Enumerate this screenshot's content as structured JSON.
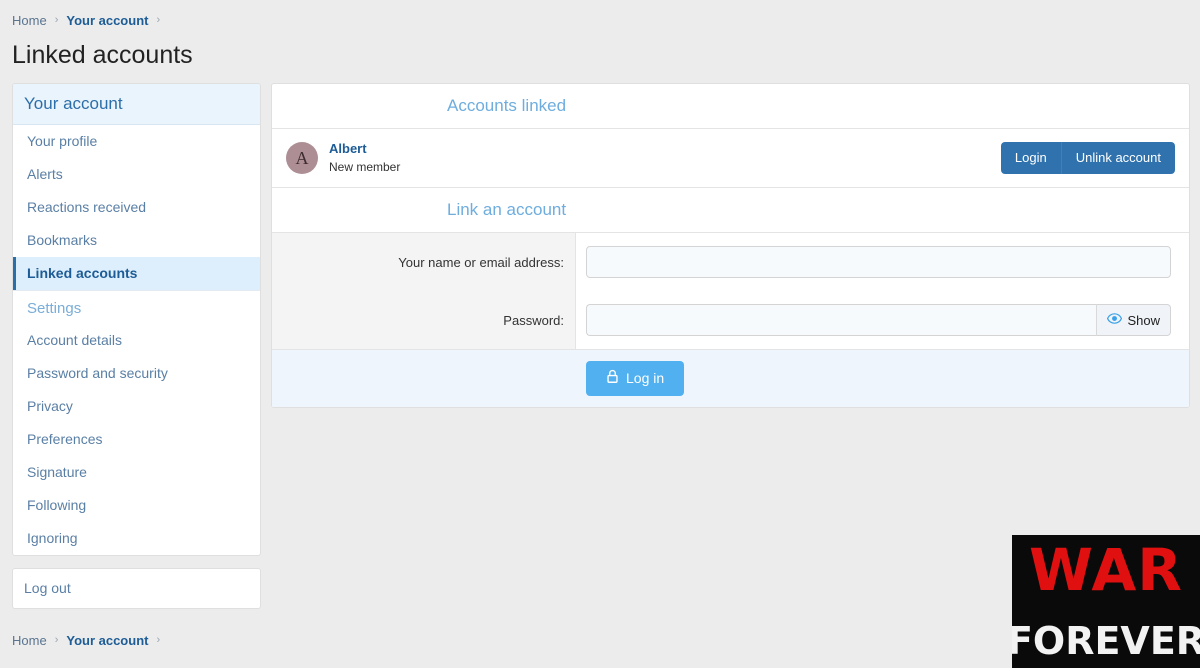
{
  "breadcrumb": {
    "home": "Home",
    "account": "Your account",
    "separator": "›"
  },
  "page": {
    "title": "Linked accounts"
  },
  "sidebar": {
    "header": "Your account",
    "items": [
      {
        "label": "Your profile",
        "active": false,
        "type": "link"
      },
      {
        "label": "Alerts",
        "active": false,
        "type": "link"
      },
      {
        "label": "Reactions received",
        "active": false,
        "type": "link"
      },
      {
        "label": "Bookmarks",
        "active": false,
        "type": "link"
      },
      {
        "label": "Linked accounts",
        "active": true,
        "type": "link"
      },
      {
        "label": "Settings",
        "active": false,
        "type": "sub-header"
      },
      {
        "label": "Account details",
        "active": false,
        "type": "link"
      },
      {
        "label": "Password and security",
        "active": false,
        "type": "link"
      },
      {
        "label": "Privacy",
        "active": false,
        "type": "link"
      },
      {
        "label": "Preferences",
        "active": false,
        "type": "link"
      },
      {
        "label": "Signature",
        "active": false,
        "type": "link"
      },
      {
        "label": "Following",
        "active": false,
        "type": "link"
      },
      {
        "label": "Ignoring",
        "active": false,
        "type": "link"
      }
    ],
    "logout": "Log out"
  },
  "main": {
    "accounts_linked_header": "Accounts linked",
    "linked_account": {
      "avatar_initial": "A",
      "name": "Albert",
      "user_title": "New member",
      "login_button": "Login",
      "unlink_button": "Unlink account"
    },
    "link_account_header": "Link an account",
    "form": {
      "name_label": "Your name or email address:",
      "name_value": "",
      "name_placeholder": "",
      "password_label": "Password:",
      "password_value": "",
      "password_placeholder": "",
      "show_button": "Show",
      "submit_button": "Log in"
    }
  },
  "banner": {
    "line1": "WAR",
    "line2": "FOREVER"
  },
  "colors": {
    "page_background": "#ececec",
    "accent_blue": "#2f72ad",
    "light_blue": "#51b0ef",
    "heading_blue": "#6eadde",
    "link_blue": "#5a7fa5",
    "avatar_bg": "#ad8e94",
    "banner_red": "#e01010"
  }
}
